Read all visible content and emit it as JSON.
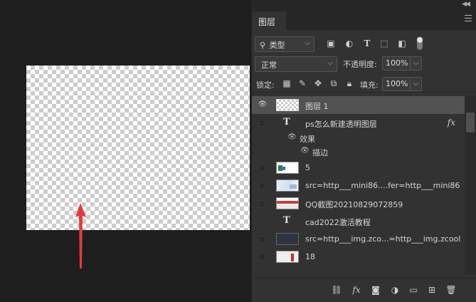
{
  "panel": {
    "tab_label": "图层",
    "filter": {
      "kind_label": "类型"
    },
    "blend": {
      "mode": "正常",
      "opacity_label": "不透明度:",
      "opacity": "100%"
    },
    "lock": {
      "label": "锁定:",
      "fill_label": "填充:",
      "fill": "100%"
    },
    "layers": [
      {
        "name": "图层 1",
        "type": "pixel",
        "visible": true,
        "selected": true
      },
      {
        "name": "ps怎么新建透明图层",
        "type": "text",
        "visible": false,
        "fx": "fx"
      },
      {
        "name": "效果",
        "type": "effects-group"
      },
      {
        "name": "描边",
        "type": "effect"
      },
      {
        "name": "5",
        "type": "pixel",
        "visible": false
      },
      {
        "name": "src=http___mini86....fer=http___mini86",
        "type": "pixel",
        "visible": false
      },
      {
        "name": "QQ截图20210829072859",
        "type": "pixel",
        "visible": false
      },
      {
        "name": "cad2022激活教程",
        "type": "text",
        "visible": false
      },
      {
        "name": "src=http___img.zco...=http___img.zcool",
        "type": "pixel",
        "visible": false
      },
      {
        "name": "18",
        "type": "pixel",
        "visible": false
      }
    ]
  },
  "colors": {
    "arrow": "#e8393a",
    "panel_bg": "#323232",
    "selected_row": "#525252"
  }
}
